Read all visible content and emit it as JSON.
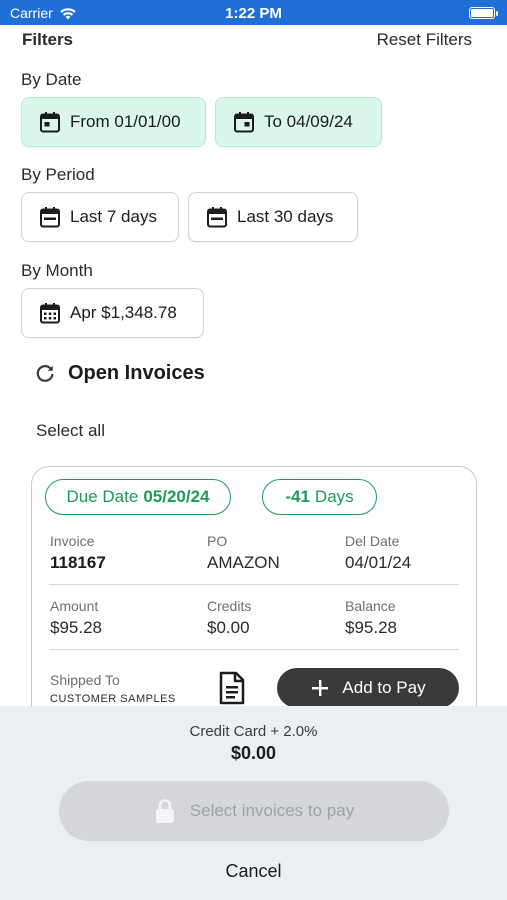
{
  "status_bar": {
    "carrier": "Carrier",
    "time": "1:22 PM"
  },
  "header": {
    "title": "Filters",
    "reset_label": "Reset Filters"
  },
  "by_date": {
    "label": "By Date",
    "from": "From 01/01/00",
    "to": "To 04/09/24"
  },
  "by_period": {
    "label": "By Period",
    "last7": "Last 7 days",
    "last30": "Last 30 days"
  },
  "by_month": {
    "label": "By Month",
    "month": "Apr $1,348.78"
  },
  "open_invoices": {
    "title": "Open Invoices",
    "select_all": "Select all"
  },
  "invoice_card": {
    "due_prefix": "Due Date",
    "due_date": "05/20/24",
    "days_value": "-41",
    "days_suffix": "Days",
    "invoice_label": "Invoice",
    "invoice_value": "118167",
    "po_label": "PO",
    "po_value": "AMAZON",
    "del_date_label": "Del Date",
    "del_date_value": "04/01/24",
    "amount_label": "Amount",
    "amount_value": "$95.28",
    "credits_label": "Credits",
    "credits_value": "$0.00",
    "balance_label": "Balance",
    "balance_value": "$95.28",
    "shipped_label": "Shipped To",
    "shipped_value": "CUSTOMER SAMPLES",
    "add_to_pay": "Add to Pay"
  },
  "payment": {
    "fee_label": "Credit Card + 2.0%",
    "total": "$0.00",
    "pay_button": "Select invoices to pay",
    "cancel": "Cancel"
  },
  "colors": {
    "status_bar": "#1f6fd6",
    "chip_green": "#d9f7ea",
    "pill_green": "#1f9a5a",
    "add_pay_bg": "#3a3a3c",
    "sheet_bg": "#eceff2"
  }
}
